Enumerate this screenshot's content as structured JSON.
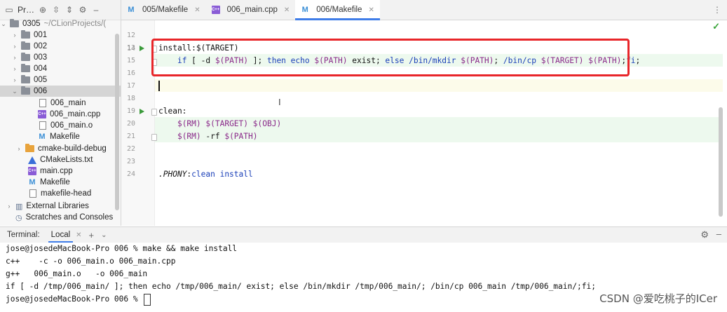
{
  "project": {
    "title": "Pr…",
    "root_name": "0305",
    "root_path": "~/CLionProjects/(",
    "items": [
      {
        "label": "001"
      },
      {
        "label": "002"
      },
      {
        "label": "003"
      },
      {
        "label": "004"
      },
      {
        "label": "005"
      },
      {
        "label": "006"
      },
      {
        "label": "006_main"
      },
      {
        "label": "006_main.cpp"
      },
      {
        "label": "006_main.o"
      },
      {
        "label": "Makefile"
      },
      {
        "label": "cmake-build-debug"
      },
      {
        "label": "CMakeLists.txt"
      },
      {
        "label": "main.cpp"
      },
      {
        "label": "Makefile"
      },
      {
        "label": "makefile-head"
      },
      {
        "label": "External Libraries"
      },
      {
        "label": "Scratches and Consoles"
      }
    ]
  },
  "tabs": [
    {
      "label": "005/Makefile",
      "icon": "makefile-icon"
    },
    {
      "label": "006_main.cpp",
      "icon": "cpp-file-icon"
    },
    {
      "label": "006/Makefile",
      "icon": "makefile-icon",
      "active": true
    }
  ],
  "editor": {
    "line_numbers": [
      "12",
      "13",
      "14",
      "15",
      "16",
      "17",
      "18",
      "19",
      "20",
      "21",
      "22",
      "23",
      "24"
    ],
    "line14": "install:$(TARGET)",
    "line15": {
      "if": "if",
      "a": " [ -d ",
      "path1": "$(PATH)",
      "b": " ]; ",
      "then": "then",
      "c": " ",
      "echo": "echo",
      "d": " ",
      "path2": "$(PATH)",
      "e": " exist; ",
      "else": "else",
      "f": " ",
      "mkdir": "/bin/mkdir",
      "g": " ",
      "path3": "$(PATH)",
      "h": "; ",
      "cp": "/bin/cp",
      "i": " ",
      "target": "$(TARGET)",
      "j": " ",
      "path4": "$(PATH)",
      "k": ";",
      "fi": "fi",
      "l": ";"
    },
    "line19": "clean:",
    "line20": {
      "rm": "$(RM)",
      "sp1": " ",
      "target": "$(TARGET)",
      "sp2": " ",
      "obj": "$(OBJ)"
    },
    "line21": {
      "rm": "$(RM)",
      "flag": " -rf ",
      "path": "$(PATH)"
    },
    "line24": {
      "phony": ".PHONY",
      "colon": ":",
      "targets": "clean install"
    }
  },
  "terminal": {
    "label": "Terminal:",
    "tab": "Local",
    "lines": [
      "jose@josedeMacBook-Pro 006 % make && make install",
      "c++    -c -o 006_main.o 006_main.cpp",
      "g++   006_main.o   -o 006_main",
      "if [ -d /tmp/006_main/ ]; then echo /tmp/006_main/ exist; else /bin/mkdir /tmp/006_main/; /bin/cp 006_main /tmp/006_main/;fi;",
      "jose@josedeMacBook-Pro 006 % "
    ]
  },
  "watermark": "CSDN @爱吃桃子的ICer",
  "colors": {
    "accent": "#3f7de8",
    "highlight_box": "#e8262a",
    "run": "#3a9a3a"
  }
}
